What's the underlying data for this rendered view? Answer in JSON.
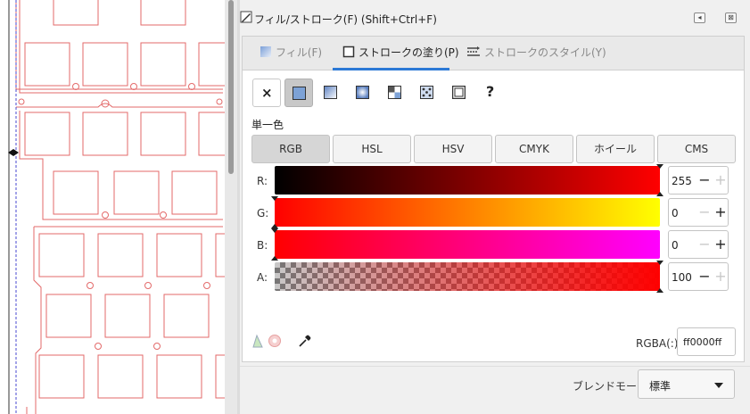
{
  "dialog": {
    "title": "フィル/ストローク(F) (Shift+Ctrl+F)",
    "icons": {
      "title_icon": "pen-icon",
      "menu_icon": "panel-menu-icon",
      "close_icon": "close-icon"
    }
  },
  "tabs": [
    {
      "label": "フィル(F)",
      "icon": "fill-icon",
      "active": false
    },
    {
      "label": "ストロークの塗り(P)",
      "icon": "stroke-paint-icon",
      "active": true
    },
    {
      "label": "ストロークのスタイル(Y)",
      "icon": "stroke-style-icon",
      "active": false
    }
  ],
  "paint_modes": [
    {
      "name": "no-paint",
      "glyph": "×"
    },
    {
      "name": "flat-color",
      "selected": true
    },
    {
      "name": "linear-gradient"
    },
    {
      "name": "radial-gradient"
    },
    {
      "name": "pattern"
    },
    {
      "name": "mesh"
    },
    {
      "name": "swatch"
    },
    {
      "name": "unset",
      "glyph": "?"
    }
  ],
  "flat_label": "単一色",
  "color_models": [
    {
      "label": "RGB",
      "selected": true
    },
    {
      "label": "HSL"
    },
    {
      "label": "HSV"
    },
    {
      "label": "CMYK"
    },
    {
      "label": "ホイール"
    },
    {
      "label": "CMS"
    }
  ],
  "channels": [
    {
      "label": "R:",
      "value": "255",
      "level": 1.0,
      "minus_enabled": true,
      "plus_enabled": false
    },
    {
      "label": "G:",
      "value": "0",
      "level": 0.0,
      "minus_enabled": false,
      "plus_enabled": true
    },
    {
      "label": "B:",
      "value": "0",
      "level": 0.0,
      "minus_enabled": false,
      "plus_enabled": true
    },
    {
      "label": "A:",
      "value": "100",
      "level": 1.0,
      "minus_enabled": true,
      "plus_enabled": false
    }
  ],
  "rgba": {
    "label": "RGBA(:):",
    "value": "ff0000ff"
  },
  "blend": {
    "label": "ブレンドモード:",
    "value": "標準"
  },
  "colors": {
    "accent": "#2c79d6",
    "stroke": "#ff0000",
    "drawing_lines": "#e36a6a"
  }
}
